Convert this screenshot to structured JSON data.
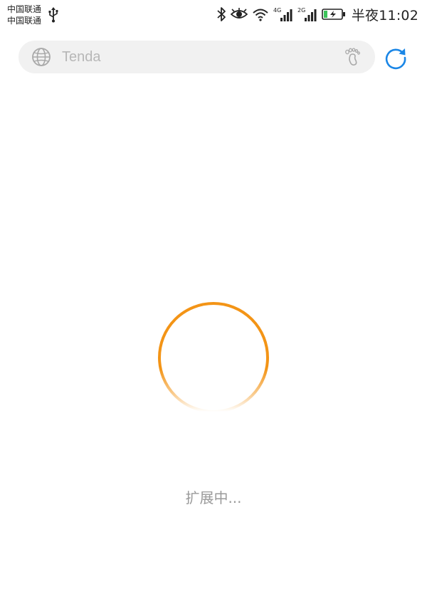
{
  "status_bar": {
    "carrier_1": "中国联通",
    "carrier_2": "中国联通",
    "time": "半夜11:02",
    "network_1": "4G",
    "network_2": "2G",
    "icons": [
      "usb-icon",
      "bluetooth-icon",
      "eye-icon",
      "wifi-icon",
      "signal-icon",
      "battery-charging-icon"
    ]
  },
  "address_bar": {
    "url": "Tenda",
    "left_icon": "globe-icon",
    "right_icon": "footprint-icon"
  },
  "toolbar": {
    "refresh_icon": "refresh-icon"
  },
  "loading": {
    "text": "扩展中...",
    "spinner_color": "#f39416"
  },
  "colors": {
    "accent_blue": "#1a86e6",
    "spinner_orange": "#f39416",
    "address_bg": "#f1f1f1"
  }
}
